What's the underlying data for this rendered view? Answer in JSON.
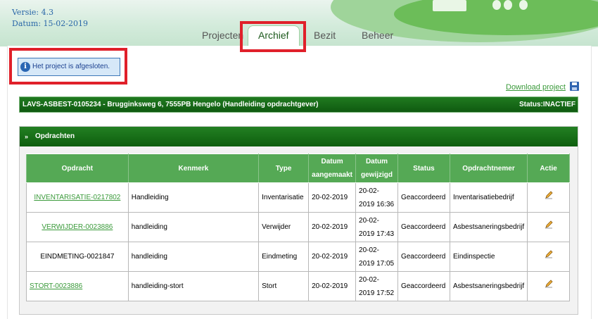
{
  "header": {
    "version": "Versie: 4.3",
    "date": "Datum: 15-02-2019"
  },
  "tabs": [
    {
      "label": "Projecten"
    },
    {
      "label": "Archief"
    },
    {
      "label": "Bezit"
    },
    {
      "label": "Beheer"
    }
  ],
  "active_tab": "Archief",
  "info_message": "Het project is afgesloten.",
  "download_label": "Download project",
  "project": {
    "title": "LAVS-ASBEST-0105234 - Brugginksweg 6, 7555PB Hengelo (Handleiding opdrachtgever)",
    "status": "Status:INACTIEF"
  },
  "panel_title": "Opdrachten",
  "table": {
    "headers": [
      "Opdracht",
      "Kenmerk",
      "Type",
      "Datum aangemaakt",
      "Datum gewijzigd",
      "Status",
      "Opdrachtnemer",
      "Actie"
    ],
    "rows": [
      {
        "opdracht": "INVENTARISATIE-0217802",
        "kenmerk": "Handleiding",
        "type": "Inventarisatie",
        "aangemaakt": "20-02-2019",
        "gewijzigd": "20-02-2019 16:36",
        "status": "Geaccordeerd",
        "opdrachtnemer": "Inventarisatiebedrijf"
      },
      {
        "opdracht": "VERWIJDER-0023886",
        "kenmerk": "handleiding",
        "type": "Verwijder",
        "aangemaakt": "20-02-2019",
        "gewijzigd": "20-02-2019 17:43",
        "status": "Geaccordeerd",
        "opdrachtnemer": "Asbestsaneringsbedrijf"
      },
      {
        "opdracht": "EINDMETING-0021847",
        "kenmerk": "handleiding",
        "type": "Eindmeting",
        "aangemaakt": "20-02-2019",
        "gewijzigd": "20-02-2019 17:05",
        "status": "Geaccordeerd",
        "opdrachtnemer": "Eindinspectie"
      },
      {
        "opdracht": "STORT-0023886",
        "kenmerk": "handleiding-stort",
        "type": "Stort",
        "aangemaakt": "20-02-2019",
        "gewijzigd": "20-02-2019 17:52",
        "status": "Geaccordeerd",
        "opdrachtnemer": "Asbestsaneringsbedrijf"
      }
    ]
  },
  "colors": {
    "accent_green": "#1a6e1a",
    "highlight_red": "#e0202a",
    "info_blue": "#2a66b3"
  }
}
